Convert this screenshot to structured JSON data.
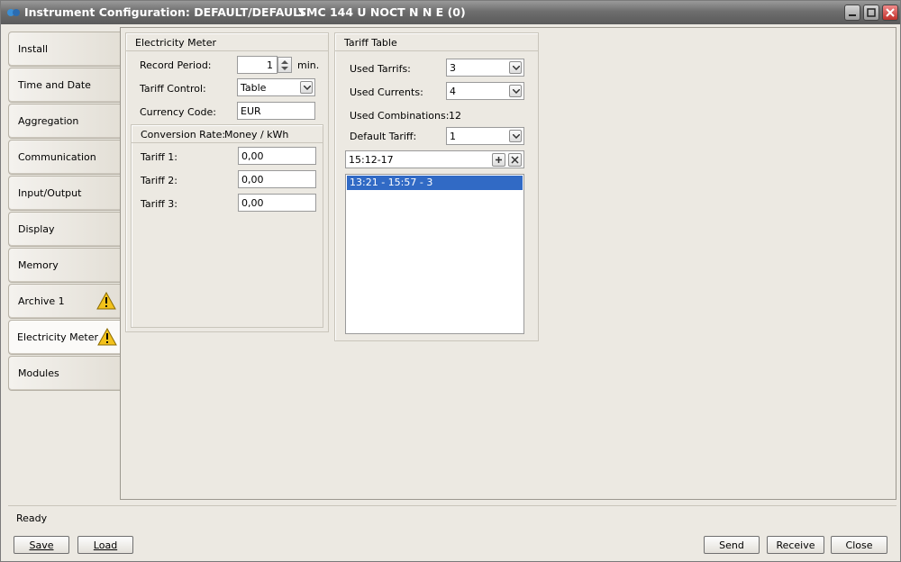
{
  "window": {
    "title": "Instrument Configuration: DEFAULT/DEFAULT",
    "subtitle": "SMC 144 U NOCT N N E (0)"
  },
  "tabs": [
    {
      "label": "Install",
      "warning": false
    },
    {
      "label": "Time and Date",
      "warning": false
    },
    {
      "label": "Aggregation",
      "warning": false
    },
    {
      "label": "Communication",
      "warning": false
    },
    {
      "label": "Input/Output",
      "warning": false
    },
    {
      "label": "Display",
      "warning": false
    },
    {
      "label": "Memory",
      "warning": false
    },
    {
      "label": "Archive 1",
      "warning": true
    },
    {
      "label": "Electricity Meter",
      "warning": true,
      "active": true
    },
    {
      "label": "Modules",
      "warning": false
    }
  ],
  "meter": {
    "title": "Electricity Meter",
    "record_period_label": "Record Period:",
    "record_period_value": "1",
    "record_period_unit": "min.",
    "tariff_control_label": "Tariff Control:",
    "tariff_control_value": "Table",
    "currency_label": "Currency Code:",
    "currency_value": "EUR",
    "conversion_label": "Conversion Rate:",
    "conversion_unit": "Money / kWh",
    "tariffs": [
      {
        "label": "Tariff 1:",
        "value": "0,00"
      },
      {
        "label": "Tariff 2:",
        "value": "0,00"
      },
      {
        "label": "Tariff 3:",
        "value": "0,00"
      }
    ]
  },
  "tariff_table": {
    "title": "Tariff Table",
    "used_tariffs_label": "Used Tarrifs:",
    "used_tariffs_value": "3",
    "used_currents_label": "Used Currents:",
    "used_currents_value": "4",
    "used_combinations_label": "Used Combinations:",
    "used_combinations_value": "12",
    "default_tariff_label": "Default Tariff:",
    "default_tariff_value": "1",
    "entry_value": "15:12-17",
    "entries": [
      "13:21 - 15:57 - 3"
    ]
  },
  "status": "Ready",
  "buttons": {
    "save": "Save",
    "load": "Load",
    "send": "Send",
    "receive": "Receive",
    "close": "Close"
  },
  "colors": {
    "selection": "#316ac5",
    "warning": "#f3c21b"
  }
}
